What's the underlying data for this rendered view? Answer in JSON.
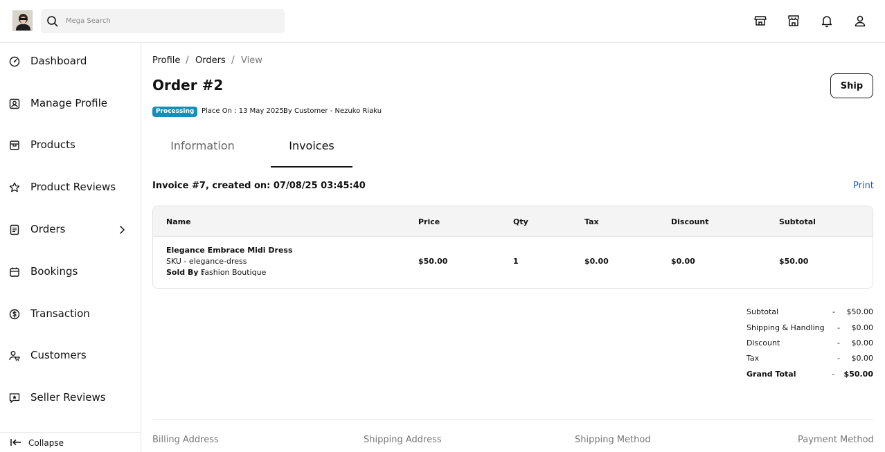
{
  "search": {
    "placeholder": "Mega Search"
  },
  "sidebar": {
    "items": [
      {
        "label": "Dashboard"
      },
      {
        "label": "Manage Profile"
      },
      {
        "label": "Products"
      },
      {
        "label": "Product Reviews"
      },
      {
        "label": "Orders"
      },
      {
        "label": "Bookings"
      },
      {
        "label": "Transaction"
      },
      {
        "label": "Customers"
      },
      {
        "label": "Seller Reviews"
      }
    ],
    "collapse_label": "Collapse"
  },
  "breadcrumb": {
    "profile": "Profile",
    "orders": "Orders",
    "view": "View",
    "sep": "/"
  },
  "order": {
    "title": "Order #2",
    "status": "Processing",
    "placed_on": "Place On : 13 May 2025,",
    "by_customer": "By Customer - Nezuko Riaku",
    "ship_label": "Ship"
  },
  "tabs": {
    "information": "Information",
    "invoices": "Invoices"
  },
  "invoice": {
    "title": "Invoice #7, created on: 07/08/25 03:45:40",
    "print_label": "Print",
    "columns": [
      "Name",
      "Price",
      "Qty",
      "Tax",
      "Discount",
      "Subtotal"
    ],
    "item": {
      "name": "Elegance Embrace Midi Dress",
      "sku": "SKU - elegance-dress",
      "sold_by_label": "Sold By :",
      "sold_by": "Fashion Boutique",
      "price": "$50.00",
      "qty": "1",
      "tax": "$0.00",
      "discount": "$0.00",
      "subtotal": "$50.00"
    }
  },
  "summary": {
    "dash": "-",
    "rows": [
      {
        "label": "Subtotal",
        "value": "$50.00"
      },
      {
        "label": "Shipping & Handling",
        "value": "$0.00"
      },
      {
        "label": "Discount",
        "value": "$0.00"
      },
      {
        "label": "Tax",
        "value": "$0.00"
      },
      {
        "label": "Grand Total",
        "value": "$50.00"
      }
    ]
  },
  "addresses": {
    "billing": "Billing Address",
    "shipping": "Shipping Address",
    "method": "Shipping Method",
    "payment": "Payment Method"
  }
}
